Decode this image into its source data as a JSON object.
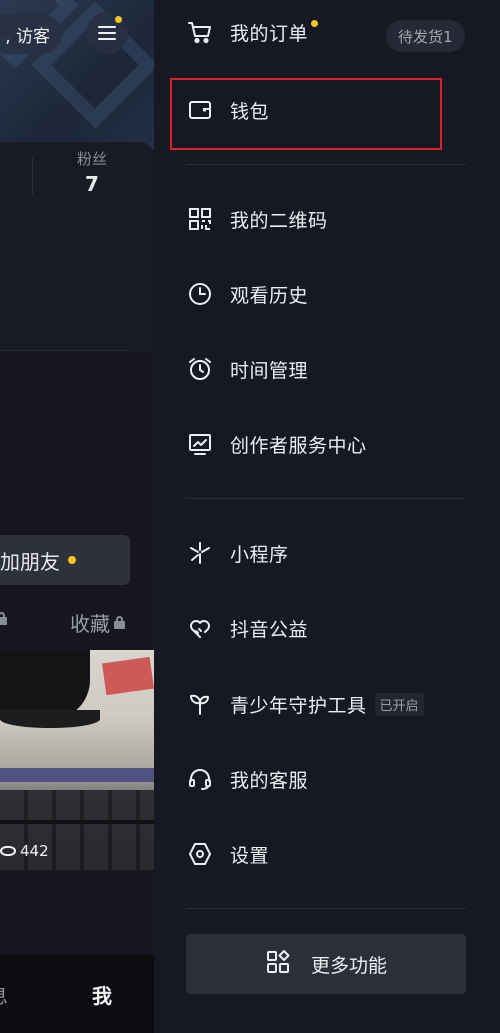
{
  "profile_background": {
    "visitor_label": ", 访客",
    "fans": {
      "label": "粉丝",
      "value": "7"
    },
    "add_friend_label": "加朋友",
    "tabs": {
      "left_fragment": "",
      "collect_label": "收藏"
    },
    "video_views": "442",
    "bottom_nav": {
      "messages_fragment": "息",
      "me_label": "我"
    }
  },
  "drawer": {
    "items": [
      {
        "label": "我的订单",
        "icon": "cart-icon",
        "badge": "待发货1",
        "has_dot": true
      },
      {
        "label": "钱包",
        "icon": "wallet-icon",
        "highlighted": true
      },
      {
        "label": "我的二维码",
        "icon": "qrcode-icon"
      },
      {
        "label": "观看历史",
        "icon": "clock-icon"
      },
      {
        "label": "时间管理",
        "icon": "alarm-icon"
      },
      {
        "label": "创作者服务中心",
        "icon": "chart-monitor-icon"
      },
      {
        "label": "小程序",
        "icon": "mini-program-icon"
      },
      {
        "label": "抖音公益",
        "icon": "heart-hand-icon"
      },
      {
        "label": "青少年守护工具",
        "icon": "sprout-icon",
        "tag": "已开启"
      },
      {
        "label": "我的客服",
        "icon": "headset-icon"
      },
      {
        "label": "设置",
        "icon": "settings-hexagon-icon"
      }
    ],
    "more_button_label": "更多功能",
    "more_button_icon": "apps-grid-icon"
  },
  "colors": {
    "accent_dot": "#f5c520",
    "highlight_border": "#e0202a",
    "drawer_bg": "#161823"
  }
}
